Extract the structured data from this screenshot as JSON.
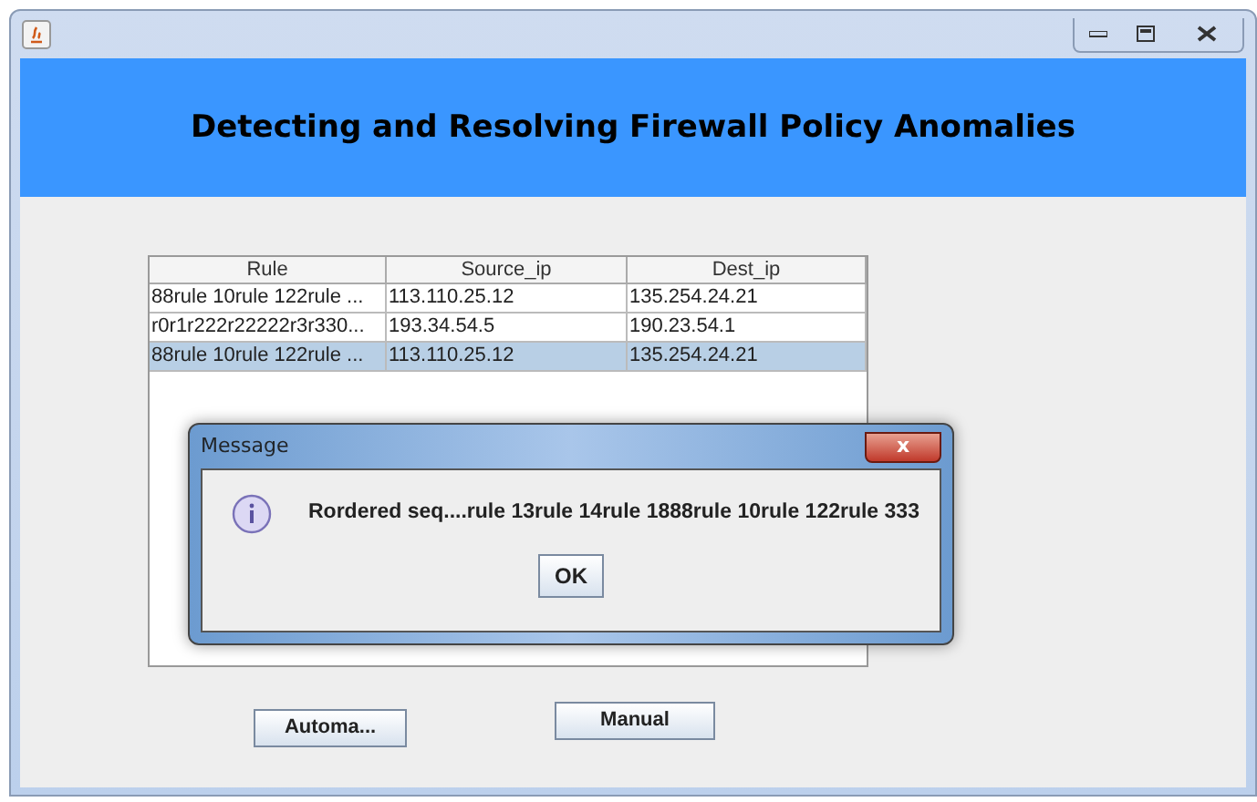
{
  "header": {
    "title": "Detecting and Resolving Firewall Policy Anomalies"
  },
  "table": {
    "columns": [
      "Rule",
      "Source_ip",
      "Dest_ip"
    ],
    "rows": [
      {
        "cells": [
          "88rule 10rule 122rule ...",
          "113.110.25.12",
          "135.254.24.21"
        ],
        "selected": false
      },
      {
        "cells": [
          "r0r1r222r22222r3r330...",
          "193.34.54.5",
          "190.23.54.1"
        ],
        "selected": false
      },
      {
        "cells": [
          "88rule 10rule 122rule ...",
          "113.110.25.12",
          "135.254.24.21"
        ],
        "selected": true
      }
    ]
  },
  "buttons": [
    {
      "label": "Automa..."
    },
    {
      "label": "Manual"
    }
  ],
  "dialog": {
    "title": "Message",
    "close": "x",
    "message": "Rordered seq....rule 13rule 14rule 1888rule 10rule 122rule 333",
    "button": "OK"
  }
}
